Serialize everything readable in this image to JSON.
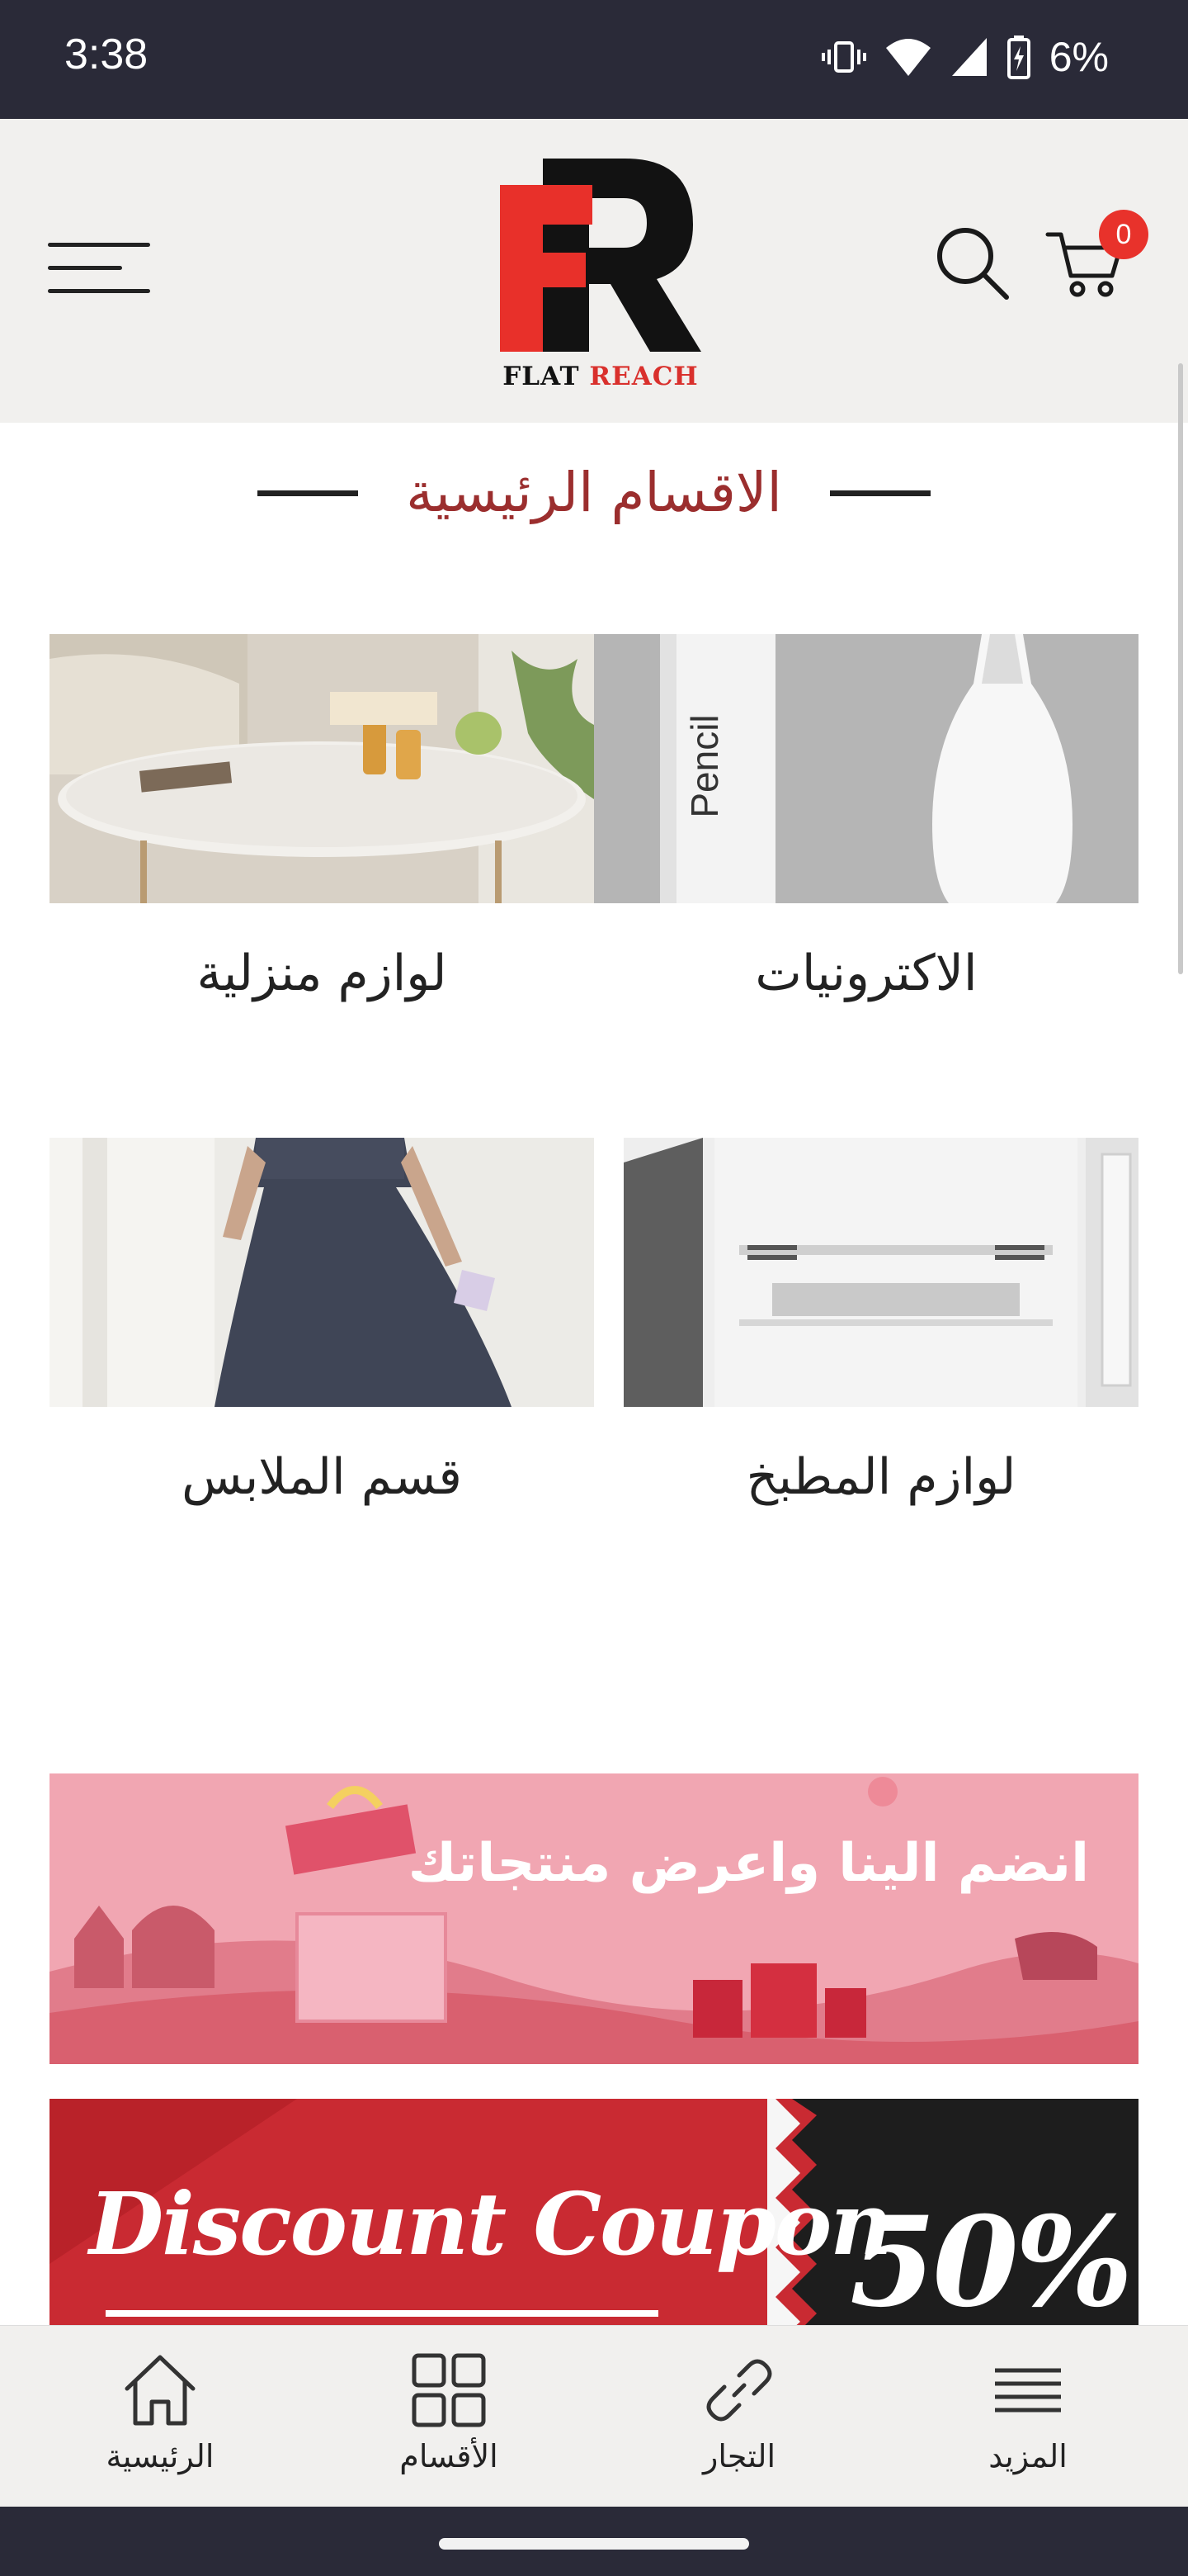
{
  "status_bar": {
    "time": "3:38",
    "battery": "6%",
    "icons": [
      "vibrate-icon",
      "wifi-icon",
      "signal-icon",
      "battery-charging-icon"
    ]
  },
  "header": {
    "logo": {
      "flat": "FLAT",
      "reach": "REACH"
    },
    "cart_count": "0",
    "icons": [
      "menu-icon",
      "search-icon",
      "cart-icon"
    ]
  },
  "section": {
    "title": "الاقسام الرئيسية"
  },
  "categories": [
    {
      "label": "الاكترونيات",
      "image": "pencil-product"
    },
    {
      "label": "لوازم منزلية",
      "image": "living-room-table"
    },
    {
      "label": "لوازم المطبخ",
      "image": "refrigerator"
    },
    {
      "label": "قسم الملابس",
      "image": "dress"
    }
  ],
  "banners": {
    "join": "انضم الينا واعرض منتجاتك",
    "coupon": "Discount Coupon",
    "coupon_percent": "50%"
  },
  "bottom_nav": [
    {
      "label": "الرئيسية",
      "icon": "home-icon"
    },
    {
      "label": "الأقسام",
      "icon": "grid-icon"
    },
    {
      "label": "التجار",
      "icon": "link-icon"
    },
    {
      "label": "المزيد",
      "icon": "more-lines-icon"
    }
  ],
  "colors": {
    "accent": "#9b2e2e",
    "logo_red": "#e8302a",
    "badge": "#e8322b",
    "status_bar": "#2a2a38",
    "header_bg": "#f1f0ee"
  }
}
